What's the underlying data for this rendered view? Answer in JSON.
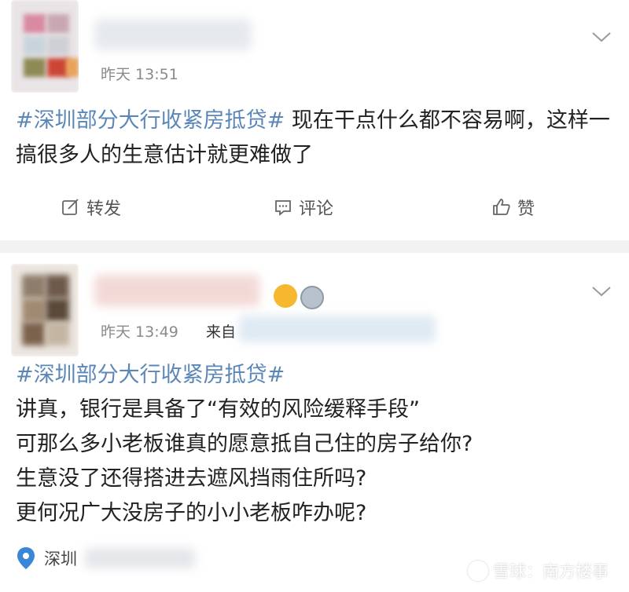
{
  "posts": [
    {
      "timestamp": "昨天 13:51",
      "hashtag": "#深圳部分大行收紧房抵贷#",
      "body": " 现在干点什么都不容易啊，这样一搞很多人的生意估计就更难做了",
      "actions": {
        "repost": "转发",
        "comment": "评论",
        "like": "赞"
      }
    },
    {
      "timestamp": "昨天 13:49",
      "source_prefix": "来自",
      "hashtag": "#深圳部分大行收紧房抵贷#",
      "lines": [
        "讲真，银行是具备了“有效的风险缓释手段”",
        "可那么多小老板谁真的愿意抵自己住的房子给你?",
        "生意没了还得搭进去遮风挡雨住所吗?",
        "更何况广大没房子的小小老板咋办呢?"
      ],
      "location": "深圳"
    }
  ],
  "watermark": "雪球：南方楼事",
  "colors": {
    "hashtag": "#5b87b8",
    "separator": "#f2f2f2",
    "timestamp": "#8a8a8a"
  }
}
